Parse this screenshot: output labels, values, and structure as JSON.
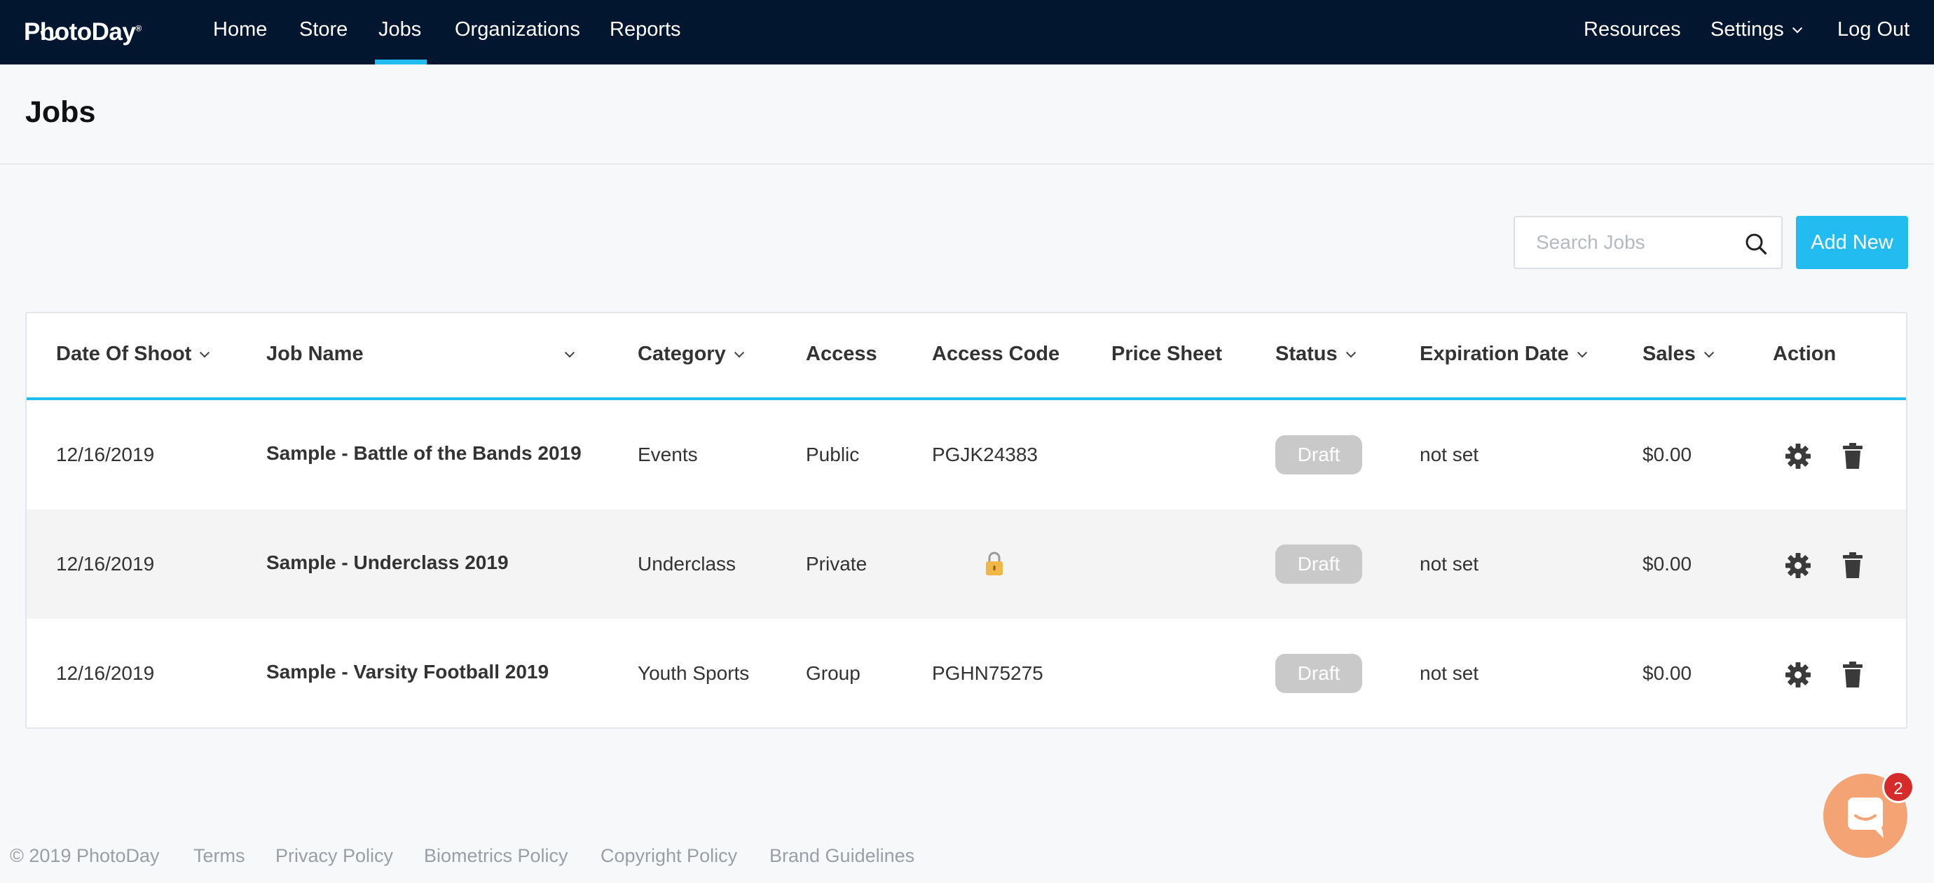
{
  "nav": {
    "logo": "PhotoDay",
    "logo_mark": "®",
    "items": [
      {
        "label": "Home"
      },
      {
        "label": "Store"
      },
      {
        "label": "Jobs"
      },
      {
        "label": "Organizations"
      },
      {
        "label": "Reports"
      }
    ],
    "active": "Jobs",
    "right": {
      "resources": "Resources",
      "settings": "Settings",
      "logout": "Log Out"
    }
  },
  "page": {
    "title": "Jobs"
  },
  "toolbar": {
    "search_placeholder": "Search Jobs",
    "search_value": "",
    "add_label": "Add New"
  },
  "table": {
    "columns": {
      "date": "Date Of Shoot",
      "name": "Job Name",
      "category": "Category",
      "access": "Access",
      "code": "Access Code",
      "price": "Price Sheet",
      "status": "Status",
      "expiration": "Expiration Date",
      "sales": "Sales",
      "action": "Action"
    },
    "rows": [
      {
        "date": "12/16/2019",
        "name": "Sample - Battle of the Bands 2019",
        "category": "Events",
        "access": "Public",
        "code": "PGJK24383",
        "price": "",
        "status": "Draft",
        "expiration": "not set",
        "sales": "$0.00"
      },
      {
        "date": "12/16/2019",
        "name": "Sample - Underclass 2019",
        "category": "Underclass",
        "access": "Private",
        "code": "",
        "price": "",
        "status": "Draft",
        "expiration": "not set",
        "sales": "$0.00"
      },
      {
        "date": "12/16/2019",
        "name": "Sample - Varsity Football 2019",
        "category": "Youth Sports",
        "access": "Group",
        "code": "PGHN75275",
        "price": "",
        "status": "Draft",
        "expiration": "not set",
        "sales": "$0.00"
      }
    ]
  },
  "footer": {
    "copyright": "© 2019 PhotoDay",
    "links": [
      "Terms",
      "Privacy Policy",
      "Biometrics Policy",
      "Copyright Policy",
      "Brand Guidelines"
    ]
  },
  "chat": {
    "badge_count": "2"
  },
  "colors": {
    "nav_bg": "#03162f",
    "accent": "#23bcf0",
    "draft_badge": "#c9c9c9",
    "chat_bg": "#f4a374",
    "notification": "#d52b2b"
  },
  "icons": [
    "search-icon",
    "chevron-down-icon",
    "lock-icon",
    "gear-icon",
    "trash-icon",
    "chat-icon"
  ]
}
